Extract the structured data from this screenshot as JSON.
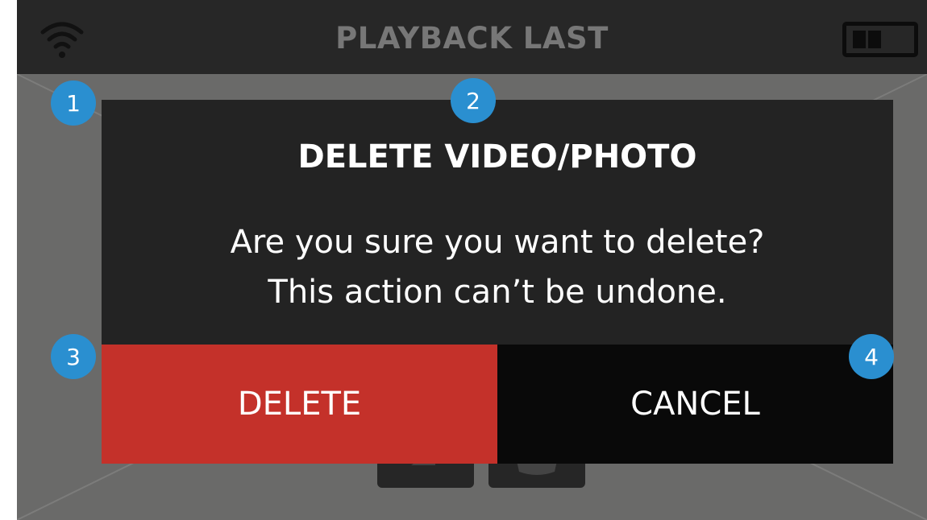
{
  "header": {
    "title": "PLAYBACK LAST",
    "wifi_icon": "wifi-icon",
    "battery_icon": "battery-icon"
  },
  "background_controls": {
    "play_icon": "play-icon",
    "trash_icon": "trash-icon"
  },
  "dialog": {
    "title": "DELETE VIDEO/PHOTO",
    "message_line1": "Are you sure you want to delete?",
    "message_line2": "This action can’t be undone.",
    "delete_label": "DELETE",
    "cancel_label": "CANCEL"
  },
  "markers": [
    "1",
    "2",
    "3",
    "4"
  ],
  "colors": {
    "delete": "#c4312a",
    "cancel": "#090909",
    "dialog": "#232323",
    "marker": "#2a8fd0",
    "screen": "#6a6a69"
  }
}
